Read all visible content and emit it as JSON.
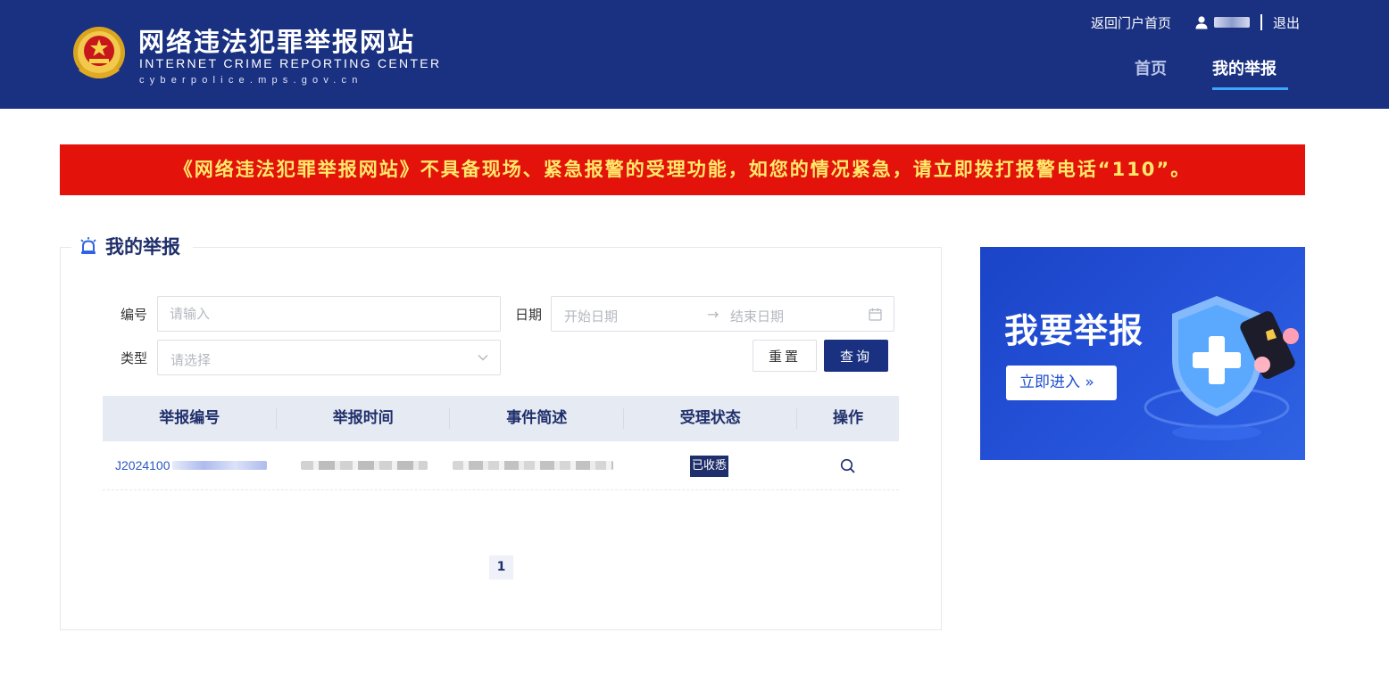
{
  "header": {
    "site_title_cn": "网络违法犯罪举报网站",
    "site_title_en": "INTERNET CRIME REPORTING CENTER",
    "site_url": "cyberpolice.mps.gov.cn",
    "portal_link": "返回门户首页",
    "logout": "退出",
    "nav": [
      {
        "label": "首页",
        "active": false
      },
      {
        "label": "我的举报",
        "active": true
      }
    ],
    "colors": {
      "bg": "#1a3182",
      "active_underline": "#3ea6ff"
    }
  },
  "alert": {
    "text": "《网络违法犯罪举报网站》不具备现场、紧急报警的受理功能，如您的情况紧急，请立即拨打报警电话“110”。",
    "bg": "#e3120b",
    "color": "#ffe96a"
  },
  "panel": {
    "title": "我的举报",
    "icon": "alarm-bell-icon"
  },
  "filters": {
    "id_label": "编号",
    "id_placeholder": "请输入",
    "date_label": "日期",
    "date_start_placeholder": "开始日期",
    "date_arrow": "→",
    "date_end_placeholder": "结束日期",
    "type_label": "类型",
    "type_placeholder": "请选择",
    "reset": "重置",
    "query": "查询"
  },
  "table": {
    "columns": [
      "举报编号",
      "举报时间",
      "事件简述",
      "受理状态",
      "操作"
    ],
    "rows": [
      {
        "id_prefix": "J2024100",
        "status": "已收悉",
        "action_icon": "search-icon"
      }
    ]
  },
  "pagination": {
    "current": "1"
  },
  "banner": {
    "title": "我要举报",
    "button": "立即进入 »",
    "art_icon": "shield-plus-icon"
  }
}
